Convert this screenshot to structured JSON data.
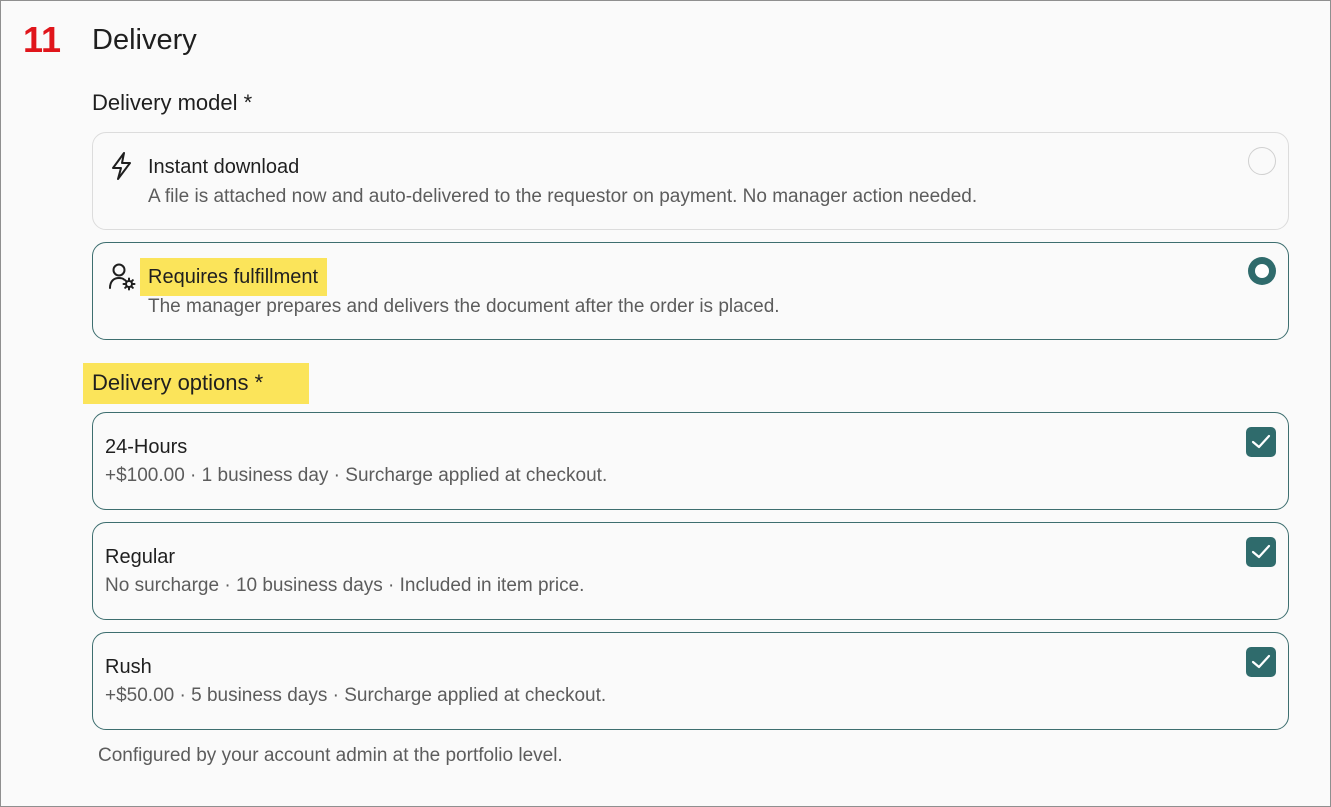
{
  "section": {
    "step_number": "11",
    "title": "Delivery"
  },
  "delivery_model": {
    "label": "Delivery model *",
    "options": [
      {
        "icon": "lightning-bolt-icon",
        "title": "Instant download",
        "description": "A file is attached now and auto-delivered to the requestor on payment. No manager action needed.",
        "selected": false
      },
      {
        "icon": "user-gear-icon",
        "title": "Requires fulfillment",
        "description": "The manager prepares and delivers the document after the order is placed.",
        "selected": true
      }
    ]
  },
  "delivery_options": {
    "label": "Delivery options *",
    "items": [
      {
        "title": "24-Hours",
        "description": "+$100.00 · 1 business day · Surcharge applied at checkout.",
        "checked": true
      },
      {
        "title": "Regular",
        "description": "No surcharge · 10 business days · Included in item price.",
        "checked": true
      },
      {
        "title": "Rush",
        "description": "+$50.00 · 5 business days · Surcharge applied at checkout.",
        "checked": true
      }
    ],
    "footnote": "Configured by your account admin at the portfolio level."
  },
  "colors": {
    "accent": "#2f6b6c",
    "highlight": "#fbe45a",
    "step_number": "#e0151b"
  }
}
